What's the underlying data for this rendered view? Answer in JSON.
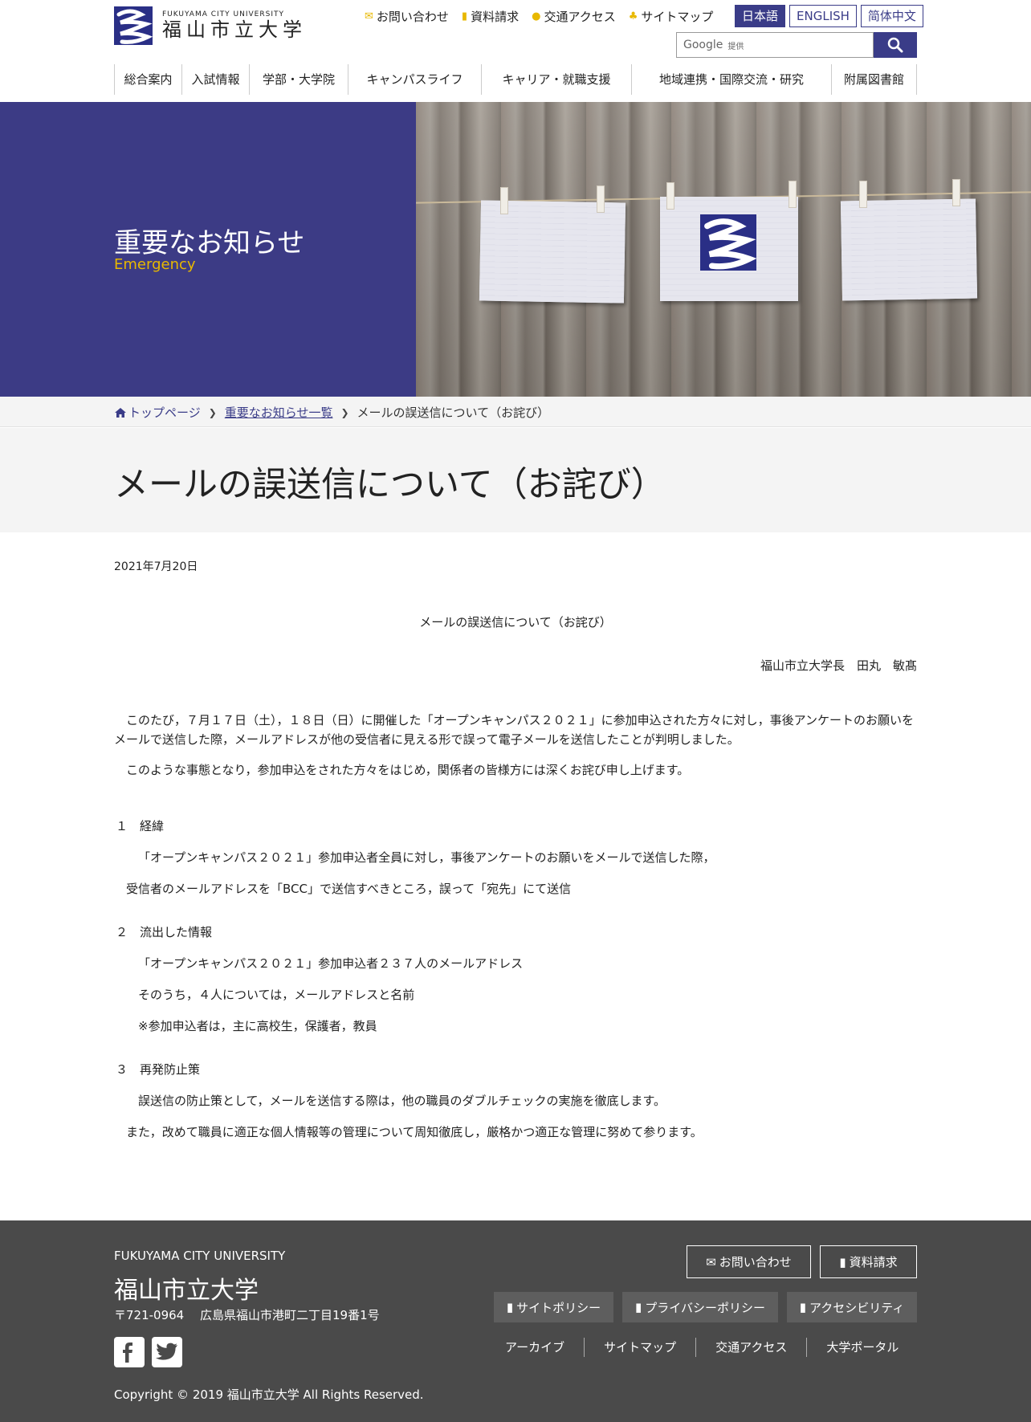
{
  "header": {
    "logo_en": "FUKUYAMA CITY UNIVERSITY",
    "logo_jp": "福山市立大学",
    "util_links": [
      {
        "icon": "envelope-icon",
        "label": "お問い合わせ"
      },
      {
        "icon": "document-icon",
        "label": "資料請求"
      },
      {
        "icon": "map-pin-icon",
        "label": "交通アクセス"
      },
      {
        "icon": "sitemap-icon",
        "label": "サイトマップ"
      }
    ],
    "languages": [
      "日本語",
      "ENGLISH",
      "简体中文"
    ],
    "search": {
      "brand": "Google",
      "provided": "提供"
    },
    "nav": [
      "総合案内",
      "入試情報",
      "学部・大学院",
      "キャンパスライフ",
      "キャリア・就職支援",
      "地域連携・国際交流・研究",
      "附属図書館"
    ]
  },
  "hero": {
    "title": "重要なお知らせ",
    "subtitle": "Emergency"
  },
  "breadcrumb": {
    "home": "トップページ",
    "list": "重要なお知らせ一覧",
    "current": "メールの誤送信について（お詫び）"
  },
  "page_title": "メールの誤送信について（お詫び）",
  "article": {
    "date": "2021年7月20日",
    "doc_title": "メールの誤送信について（お詫び）",
    "signer": "福山市立大学長　田丸　敏髙",
    "p1": "このたび，７月１７日（土），１８日（日）に開催した「オープンキャンパス２０２１」に参加申込された方々に対し，事後アンケートのお願いをメールで送信した際，メールアドレスが他の受信者に見える形で誤って電子メールを送信したことが判明しました。",
    "p2": "このような事態となり，参加申込をされた方々をはじめ，関係者の皆様方には深くお詫び申し上げます。",
    "s1_head": "１　経緯",
    "s1_l1": "「オープンキャンパス２０２１」参加申込者全員に対し，事後アンケートのお願いをメールで送信した際，",
    "s1_l2": "受信者のメールアドレスを「BCC」で送信すべきところ，誤って「宛先」にて送信",
    "s2_head": "２　流出した情報",
    "s2_l1": "「オープンキャンパス２０２１」参加申込者２３７人のメールアドレス",
    "s2_l2": "そのうち，４人については，メールアドレスと名前",
    "s2_l3": "※参加申込者は，主に高校生，保護者，教員",
    "s3_head": "３　再発防止策",
    "s3_l1": "誤送信の防止策として，メールを送信する際は，他の職員のダブルチェックの実施を徹底します。",
    "s3_l2": "また，改めて職員に適正な個人情報等の管理について周知徹底し，厳格かつ適正な管理に努めて参ります。"
  },
  "footer": {
    "name_en": "FUKUYAMA CITY UNIVERSITY",
    "name_jp": "福山市立大学",
    "address": "〒721-0964　 広島県福山市港町二丁目19番1号",
    "copyright": "Copyright © 2019 福山市立大学 All Rights Reserved.",
    "btn_contact": "お問い合わせ",
    "btn_request": "資料請求",
    "btn_site_policy": "サイトポリシー",
    "btn_privacy": "プライバシーポリシー",
    "btn_access": "アクセシビリティ",
    "links": [
      "アーカイブ",
      "サイトマップ",
      "交通アクセス",
      "大学ポータル"
    ]
  },
  "colors": {
    "brand": "#3a3c88",
    "accent": "#e8b800",
    "footer_bg": "#4a4a4a"
  }
}
